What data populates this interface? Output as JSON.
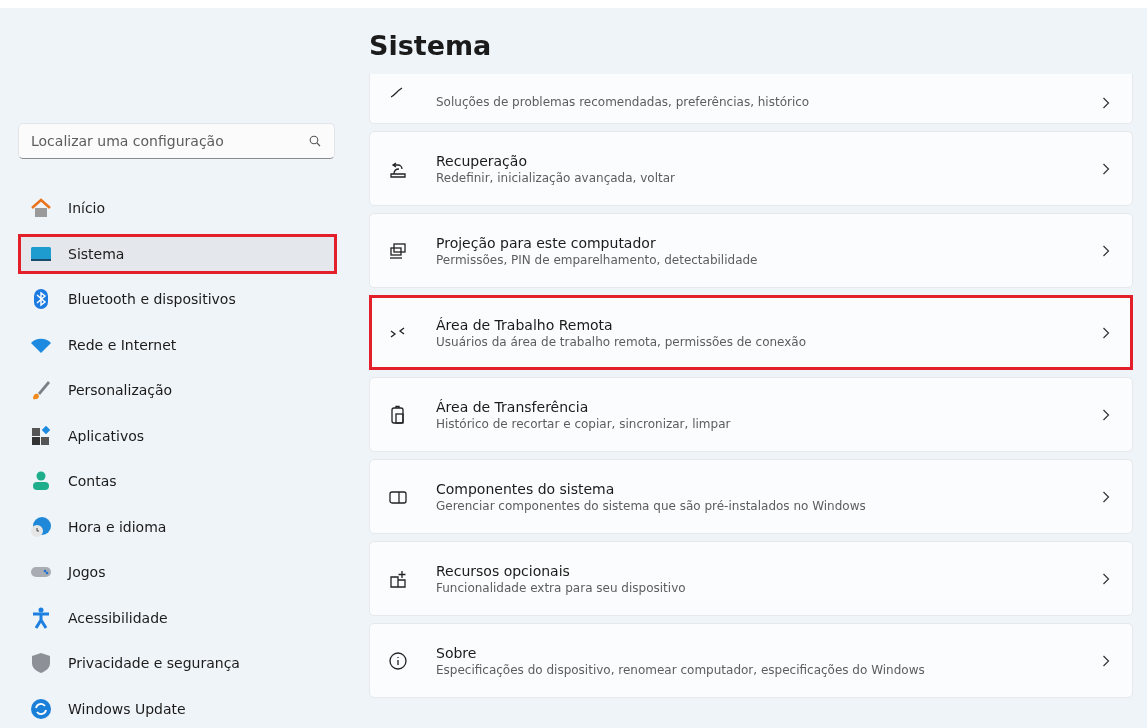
{
  "sidebar": {
    "search": {
      "placeholder": "Localizar uma configuração"
    },
    "items": [
      {
        "label": "Início",
        "selected": false,
        "highlighted": false
      },
      {
        "label": "Sistema",
        "selected": true,
        "highlighted": true
      },
      {
        "label": "Bluetooth e dispositivos",
        "selected": false,
        "highlighted": false
      },
      {
        "label": "Rede e Internet",
        "selected": false,
        "highlighted": false
      },
      {
        "label": "Personalização",
        "selected": false,
        "highlighted": false
      },
      {
        "label": "Aplicativos",
        "selected": false,
        "highlighted": false
      },
      {
        "label": "Contas",
        "selected": false,
        "highlighted": false
      },
      {
        "label": "Hora e idioma",
        "selected": false,
        "highlighted": false
      },
      {
        "label": "Jogos",
        "selected": false,
        "highlighted": false
      },
      {
        "label": "Acessibilidade",
        "selected": false,
        "highlighted": false
      },
      {
        "label": "Privacidade e segurança",
        "selected": false,
        "highlighted": false
      },
      {
        "label": "Windows Update",
        "selected": false,
        "highlighted": false
      }
    ]
  },
  "page": {
    "title": "Sistema",
    "cards": [
      {
        "description": "Soluções de problemas recomendadas, preferências, histórico",
        "highlighted": false
      },
      {
        "title": "Recuperação",
        "description": "Redefinir, inicialização avançada, voltar",
        "highlighted": false
      },
      {
        "title": "Projeção para este computador",
        "description": "Permissões, PIN de emparelhamento, detectabilidade",
        "highlighted": false
      },
      {
        "title": "Área de Trabalho Remota",
        "description": "Usuários da área de trabalho remota, permissões de conexão",
        "highlighted": true
      },
      {
        "title": "Área de Transferência",
        "description": "Histórico de recortar e copiar, sincronizar, limpar",
        "highlighted": false
      },
      {
        "title": "Componentes do sistema",
        "description": "Gerenciar componentes do sistema que são pré-instalados no Windows",
        "highlighted": false
      },
      {
        "title": "Recursos opcionais",
        "description": "Funcionalidade extra para seu dispositivo",
        "highlighted": false
      },
      {
        "title": "Sobre",
        "description": "Especificações do dispositivo, renomear computador, especificações do Windows",
        "highlighted": false
      }
    ]
  }
}
